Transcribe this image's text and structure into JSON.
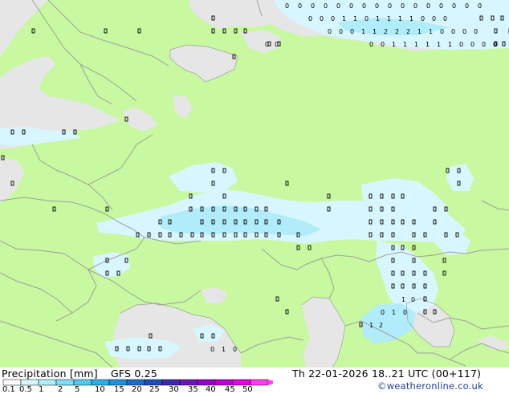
{
  "map": {
    "colors": {
      "land": "#c8f8a0",
      "sea": "#e6e6e6",
      "border": "#a0a0a0",
      "light_precip": "#d8f6ff",
      "medium_precip": "#b0ecfa",
      "strong_precip": "#50c8f0"
    },
    "grid_value_rows": [
      {
        "id": "arctic-1",
        "vals": [
          "0",
          "0",
          "0",
          "0",
          "0",
          "0",
          "0",
          "0",
          "0",
          "0",
          "0",
          "0",
          "0",
          "0",
          "0",
          "0"
        ]
      },
      {
        "id": "arctic-2",
        "vals": [
          "0",
          "0",
          "0",
          "1",
          "1",
          "0",
          "1",
          "1",
          "1",
          "1",
          "0",
          "0",
          "0"
        ]
      },
      {
        "id": "arctic-3",
        "vals": [
          "0",
          "0",
          "0",
          "1",
          "1",
          "2",
          "2",
          "2",
          "1",
          "1",
          "0",
          "0",
          "0",
          "0"
        ]
      },
      {
        "id": "arctic-4",
        "vals": [
          "0",
          "0",
          "1",
          "1",
          "1",
          "1",
          "1",
          "1",
          "0",
          "0",
          "0",
          "0"
        ]
      },
      {
        "id": "kara-2",
        "vals": [
          "0",
          "0"
        ]
      },
      {
        "id": "kazakh-1",
        "vals": [
          "1",
          "0"
        ]
      },
      {
        "id": "kazakh-2",
        "vals": [
          "0",
          "1",
          "0"
        ]
      },
      {
        "id": "kazakh-3",
        "vals": [
          "1",
          "2"
        ]
      },
      {
        "id": "georgia",
        "vals": [
          "0",
          "1",
          "0"
        ]
      }
    ]
  },
  "footer": {
    "title": "Precipitation [mm]",
    "model": "GFS 0.25",
    "datetime": "Th 22-01-2026 18..21 UTC (00+117)",
    "credit": "©weatheronline.co.uk",
    "colorbar": {
      "colors": [
        "#ffffff",
        "#d8f6ff",
        "#b0ecfa",
        "#80dcf8",
        "#50c8f0",
        "#28b0e8",
        "#1e90d8",
        "#1e6ec8",
        "#1e4cb4",
        "#3c28a8",
        "#6e14b4",
        "#9600c8",
        "#be00d2",
        "#e600dc",
        "#ff3cf0"
      ],
      "labels": [
        "0.1",
        "0.5",
        "1",
        "2",
        "5",
        "10",
        "15",
        "20",
        "25",
        "30",
        "35",
        "40",
        "45",
        "50"
      ]
    }
  }
}
